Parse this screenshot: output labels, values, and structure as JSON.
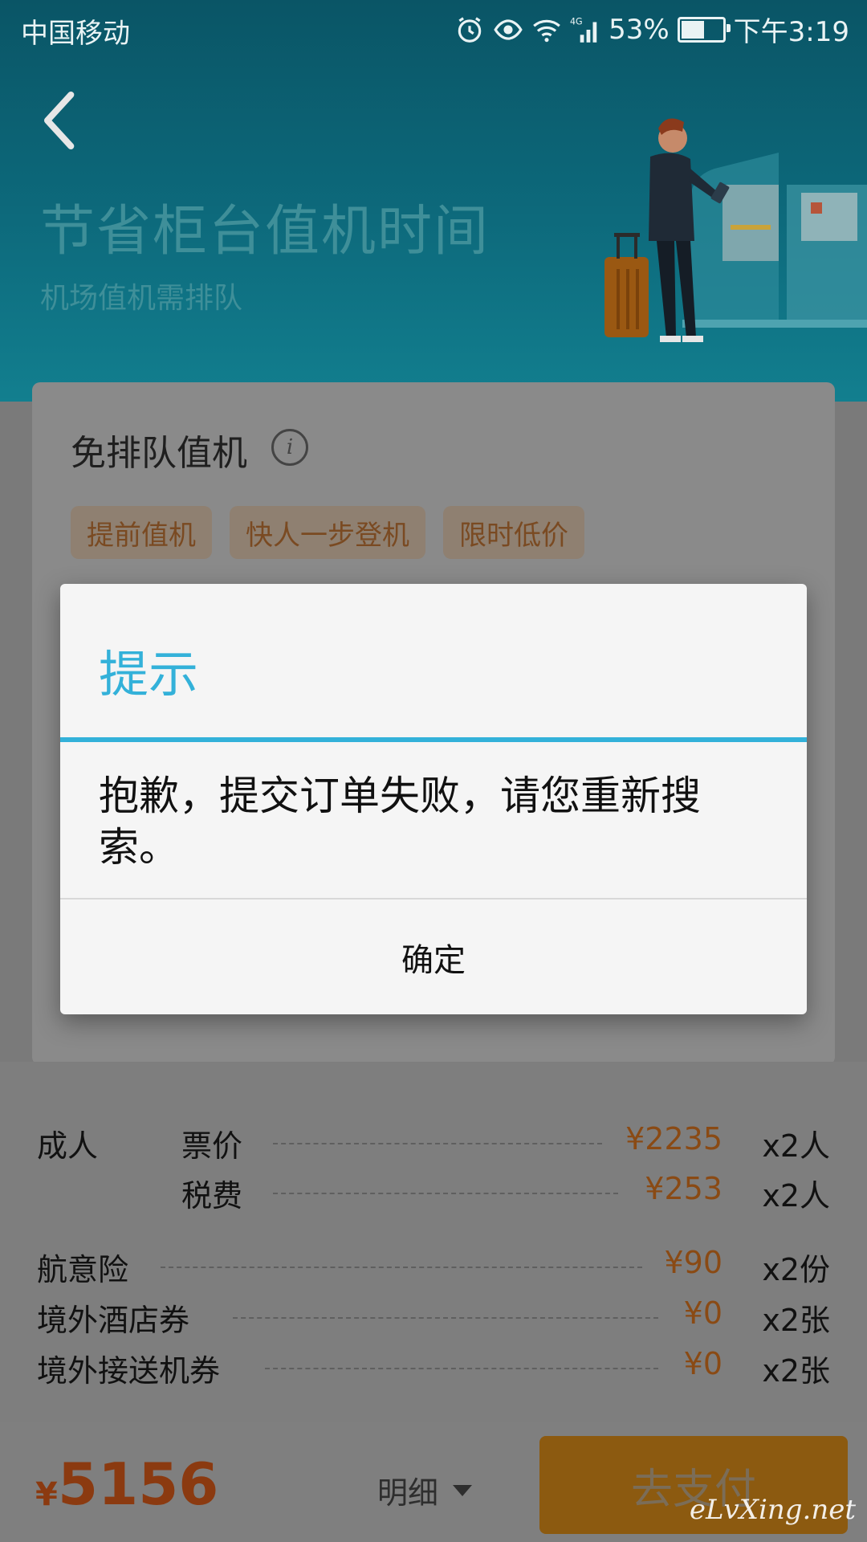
{
  "status": {
    "carrier": "中国移动",
    "network": "4G",
    "battery": "53%",
    "time": "下午3:19"
  },
  "header": {
    "title": "节省柜台值机时间",
    "subtitle": "机场值机需排队"
  },
  "card": {
    "title": "免排队值机",
    "tags": [
      "提前值机",
      "快人一步登机",
      "限时低价"
    ]
  },
  "dialog": {
    "title": "提示",
    "message": "抱歉，提交订单失败，请您重新搜索。",
    "ok_label": "确定"
  },
  "detail": {
    "rows": [
      {
        "label": "成人",
        "sub": "票价",
        "price": "¥2235",
        "qty": "x2人"
      },
      {
        "label": "",
        "sub": "税费",
        "price": "¥253",
        "qty": "x2人"
      },
      {
        "label": "航意险",
        "sub": "",
        "price": "¥90",
        "qty": "x2份"
      },
      {
        "label": "境外酒店券",
        "sub": "",
        "price": "¥0",
        "qty": "x2张"
      },
      {
        "label": "境外接送机券",
        "sub": "",
        "price": "¥0",
        "qty": "x2张"
      }
    ]
  },
  "bottom": {
    "currency": "¥",
    "total": "5156",
    "detail_label": "明细",
    "pay_label": "去支付"
  },
  "watermark": "eLvXing.net",
  "colors": {
    "accent": "#33b1d9",
    "price": "#8a4a14",
    "header_bg": "#0d6a7c"
  }
}
